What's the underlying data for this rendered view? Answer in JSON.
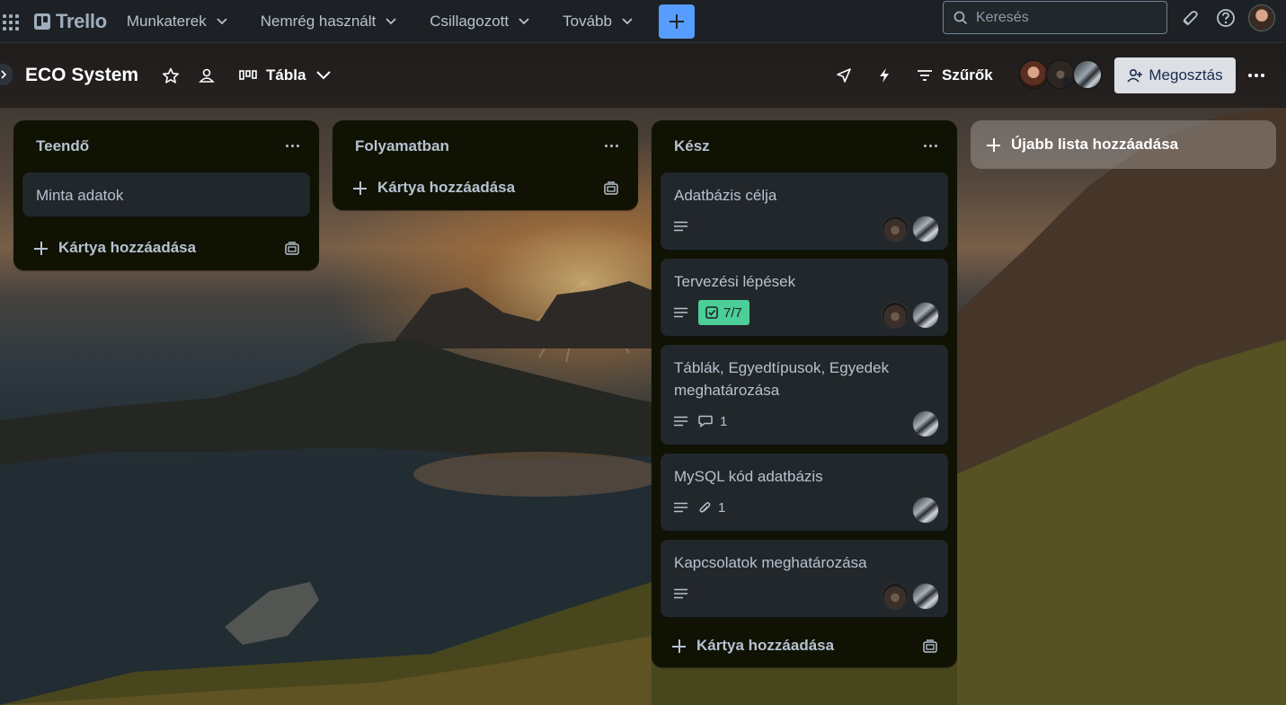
{
  "app": {
    "name": "Trello"
  },
  "topnav": {
    "items": [
      {
        "label": "Munkaterek"
      },
      {
        "label": "Nemrég használt"
      },
      {
        "label": "Csillagozott"
      },
      {
        "label": "Tovább"
      }
    ],
    "search_placeholder": "Keresés",
    "accent": "#579dff"
  },
  "board": {
    "title": "ECO System",
    "view_label": "Tábla",
    "filters_label": "Szűrők",
    "share_label": "Megosztás"
  },
  "lists": [
    {
      "title": "Teendő",
      "cards": [
        {
          "title": "Minta adatok"
        }
      ],
      "add_card_label": "Kártya hozzáadása"
    },
    {
      "title": "Folyamatban",
      "cards": [],
      "add_card_label": "Kártya hozzáadása"
    },
    {
      "title": "Kész",
      "cards": [
        {
          "title": "Adatbázis célja"
        },
        {
          "title": "Tervezési lépések",
          "checklist": "7/7"
        },
        {
          "title": "Táblák, Egyedtípusok, Egyedek meghatározása",
          "comments": "1"
        },
        {
          "title": "MySQL kód adatbázis",
          "attachments": "1"
        },
        {
          "title": "Kapcsolatok meghatározása"
        }
      ],
      "add_card_label": "Kártya hozzáadása"
    }
  ],
  "add_list_label": "Újabb lista hozzáadása",
  "colors": {
    "checklist_complete": "#4bce97",
    "list_bg": "#101204",
    "card_bg": "#22272b"
  }
}
